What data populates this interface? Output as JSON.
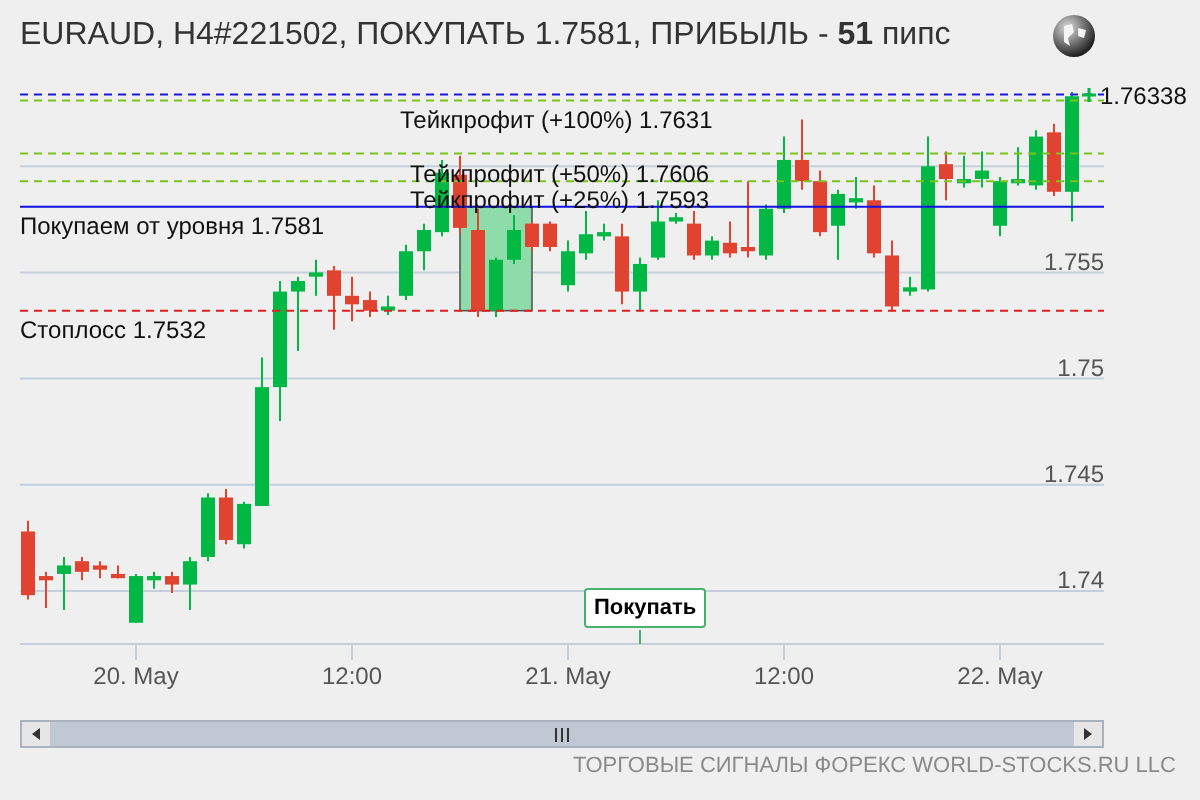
{
  "title": "EURAUD, H4#221502, ПОКУПАТЬ 1.7581, ПРИБЫЛЬ - **51** пипс",
  "chart": {
    "levels": [
      {
        "kind": "current"
      },
      {
        "kind": "takeprofit"
      },
      {
        "kind": "takeprofit"
      },
      {
        "kind": "takeprofit"
      },
      {
        "kind": "entry"
      },
      {
        "kind": "stoploss"
      }
    ],
    "chart_data": {
      "type": "candlestick",
      "categories": [
        null,
        null,
        null,
        null,
        null,
        null,
        "20. May",
        null,
        null,
        null,
        null,
        null,
        null,
        null,
        null,
        null,
        null,
        null,
        "12:00",
        null,
        null,
        null,
        null,
        null,
        null,
        null,
        null,
        null,
        null,
        null,
        "21. May",
        null,
        null,
        null,
        null,
        null,
        null,
        null,
        null,
        null,
        null,
        null,
        "12:00",
        null,
        null,
        null,
        null,
        null,
        null,
        null,
        null,
        null,
        null,
        null,
        "22. May",
        null,
        null,
        null,
        null
      ],
      "ohlc": [
        [
          1.7428,
          1.7433,
          1.7396,
          1.7398
        ],
        [
          1.7407,
          1.7409,
          1.7392,
          1.7405
        ],
        [
          1.7408,
          1.7416,
          1.7391,
          1.7412
        ],
        [
          1.7414,
          1.7416,
          1.7405,
          1.7409
        ],
        [
          1.7412,
          1.7414,
          1.7406,
          1.741
        ],
        [
          1.7408,
          1.7412,
          1.7406,
          1.7406
        ],
        [
          1.7385,
          1.7408,
          1.7385,
          1.7407
        ],
        [
          1.7405,
          1.7409,
          1.7401,
          1.7407
        ],
        [
          1.7407,
          1.7409,
          1.7399,
          1.7403
        ],
        [
          1.7403,
          1.7416,
          1.7391,
          1.7414
        ],
        [
          1.7416,
          1.7446,
          1.7414,
          1.7444
        ],
        [
          1.7444,
          1.7448,
          1.7422,
          1.7424
        ],
        [
          1.7422,
          1.7442,
          1.742,
          1.7441
        ],
        [
          1.744,
          1.751,
          1.744,
          1.7496
        ],
        [
          1.7496,
          1.7546,
          1.748,
          1.7541
        ],
        [
          1.7541,
          1.7548,
          1.7513,
          1.7546
        ],
        [
          1.7548,
          1.7556,
          1.7539,
          1.755
        ],
        [
          1.7551,
          1.7553,
          1.7523,
          1.7539
        ],
        [
          1.7539,
          1.7548,
          1.7527,
          1.7535
        ],
        [
          1.7537,
          1.7541,
          1.7529,
          1.7532
        ],
        [
          1.7532,
          1.7539,
          1.753,
          1.7534
        ],
        [
          1.7539,
          1.7563,
          1.7537,
          1.756
        ],
        [
          1.756,
          1.7573,
          1.7551,
          1.757
        ],
        [
          1.7569,
          1.7603,
          1.7567,
          1.7597
        ],
        [
          1.7596,
          1.7605,
          1.7568,
          1.7571
        ],
        [
          1.757,
          1.758,
          1.7529,
          1.7532
        ],
        [
          1.7532,
          1.7557,
          1.7529,
          1.7556
        ],
        [
          1.7556,
          1.7577,
          1.7554,
          1.757
        ],
        [
          1.7573,
          1.7574,
          1.756,
          1.7562
        ],
        [
          1.7573,
          1.7574,
          1.756,
          1.7562
        ],
        [
          1.7544,
          1.7565,
          1.7541,
          1.756
        ],
        [
          1.7559,
          1.7579,
          1.7556,
          1.7568
        ],
        [
          1.7567,
          1.7573,
          1.7565,
          1.7569
        ],
        [
          1.7567,
          1.7573,
          1.7535,
          1.7541
        ],
        [
          1.7541,
          1.7557,
          1.7532,
          1.7554
        ],
        [
          1.7557,
          1.7584,
          1.7556,
          1.7574
        ],
        [
          1.7574,
          1.7578,
          1.7573,
          1.7576
        ],
        [
          1.7573,
          1.7579,
          1.7556,
          1.7558
        ],
        [
          1.7558,
          1.7567,
          1.7556,
          1.7565
        ],
        [
          1.7564,
          1.7574,
          1.7557,
          1.7559
        ],
        [
          1.7562,
          1.7593,
          1.7557,
          1.756
        ],
        [
          1.7558,
          1.7582,
          1.7556,
          1.758
        ],
        [
          1.758,
          1.7614,
          1.7578,
          1.7603
        ],
        [
          1.7603,
          1.7622,
          1.7589,
          1.7593
        ],
        [
          1.7593,
          1.7598,
          1.7567,
          1.7569
        ],
        [
          1.7572,
          1.7589,
          1.7556,
          1.7587
        ],
        [
          1.7583,
          1.7595,
          1.758,
          1.7585
        ],
        [
          1.7584,
          1.7591,
          1.7557,
          1.7559
        ],
        [
          1.7558,
          1.7565,
          1.7532,
          1.7534
        ],
        [
          1.7541,
          1.7548,
          1.7539,
          1.7543
        ],
        [
          1.7542,
          1.7614,
          1.7541,
          1.76
        ],
        [
          1.7601,
          1.7607,
          1.7584,
          1.7594
        ],
        [
          1.7592,
          1.7605,
          1.759,
          1.7594
        ],
        [
          1.7594,
          1.7607,
          1.759,
          1.7598
        ],
        [
          1.7572,
          1.7595,
          1.7567,
          1.7593
        ],
        [
          1.7592,
          1.7609,
          1.7591,
          1.7594
        ],
        [
          1.7591,
          1.7617,
          1.7589,
          1.7614
        ],
        [
          1.7616,
          1.762,
          1.7586,
          1.7588
        ],
        [
          1.7588,
          1.7635,
          1.7574,
          1.7633
        ]
      ],
      "ylim": [
        1.7375,
        1.7635
      ],
      "yticks": [
        {
          "value": 1.755,
          "label": "1.755"
        },
        {
          "value": 1.75,
          "label": "1.75"
        },
        {
          "value": 1.745,
          "label": "1.745"
        },
        {
          "value": 1.74,
          "label": "1.74"
        }
      ],
      "grid": true,
      "ref_lines": [
        {
          "axis": "y",
          "value": 1.76338,
          "label": "1.76338"
        },
        {
          "axis": "y",
          "value": 1.7631,
          "label": "Тейкпрофит (+100%) 1.7631"
        },
        {
          "axis": "y",
          "value": 1.7606,
          "label": "Тейкпрофит (+50%) 1.7606"
        },
        {
          "axis": "y",
          "value": 1.7593,
          "label": "Тейкпрофит (+25%) 1.7593"
        },
        {
          "axis": "y",
          "value": 1.7581,
          "label": "Покупаем от уровня 1.7581"
        },
        {
          "axis": "y",
          "value": 1.7532,
          "label": "Стоплосс 1.7532"
        }
      ]
    },
    "signal_marker": "Покупать"
  },
  "footer": "ТОРГОВЫЕ СИГНАЛЫ ФОРЕКС WORLD-STOCKS.RU LLC"
}
